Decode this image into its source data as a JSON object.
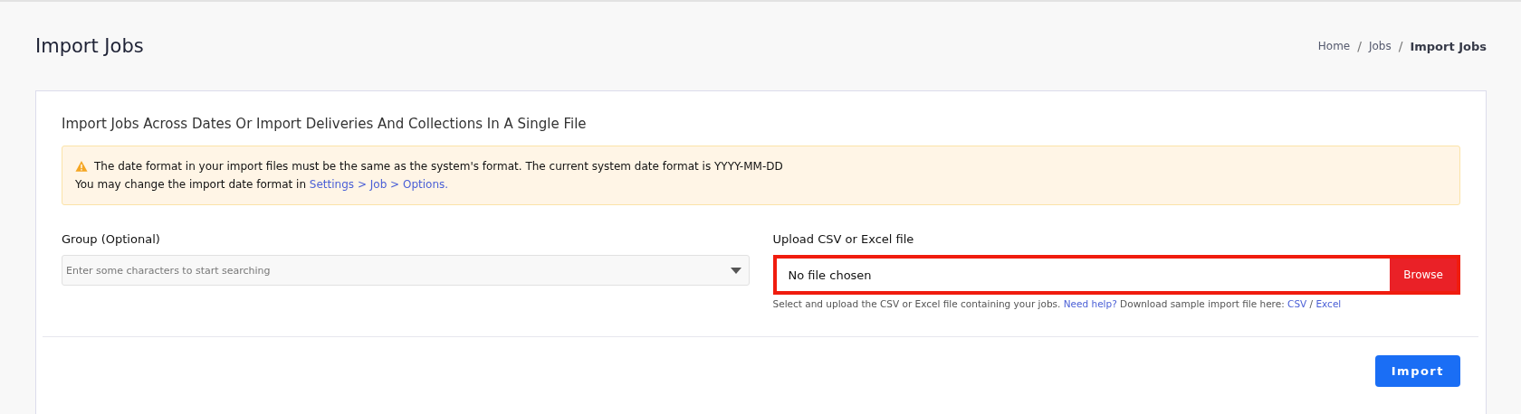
{
  "page": {
    "title": "Import Jobs"
  },
  "breadcrumb": [
    {
      "label": "Home",
      "current": false
    },
    {
      "label": "Jobs",
      "current": false
    },
    {
      "label": "Import Jobs",
      "current": true
    }
  ],
  "breadcrumb_separator": "/",
  "card": {
    "heading": "Import Jobs Across Dates Or Import Deliveries And Collections In A Single File"
  },
  "alert": {
    "line_1": "The date format in your import files must be the same as the system's format. The current system date format is YYYY-MM-DD",
    "line_2": "You may change the import date format in",
    "link": "Settings > Job > Options."
  },
  "group": {
    "label": "Group (Optional)",
    "placeholder": "Enter some characters to start searching"
  },
  "upload": {
    "label": "Upload CSV or Excel file",
    "value": "No file chosen",
    "button": "Browse",
    "error": true,
    "help_before": "Select and upload the CSV or Excel file containing your jobs.",
    "help_link": "Need help?",
    "help_after": "Download sample import file here:",
    "sample_links": [
      "CSV",
      "Excel"
    ],
    "sample_separator": "/"
  },
  "buttons": [
    {
      "label": "Import"
    }
  ]
}
